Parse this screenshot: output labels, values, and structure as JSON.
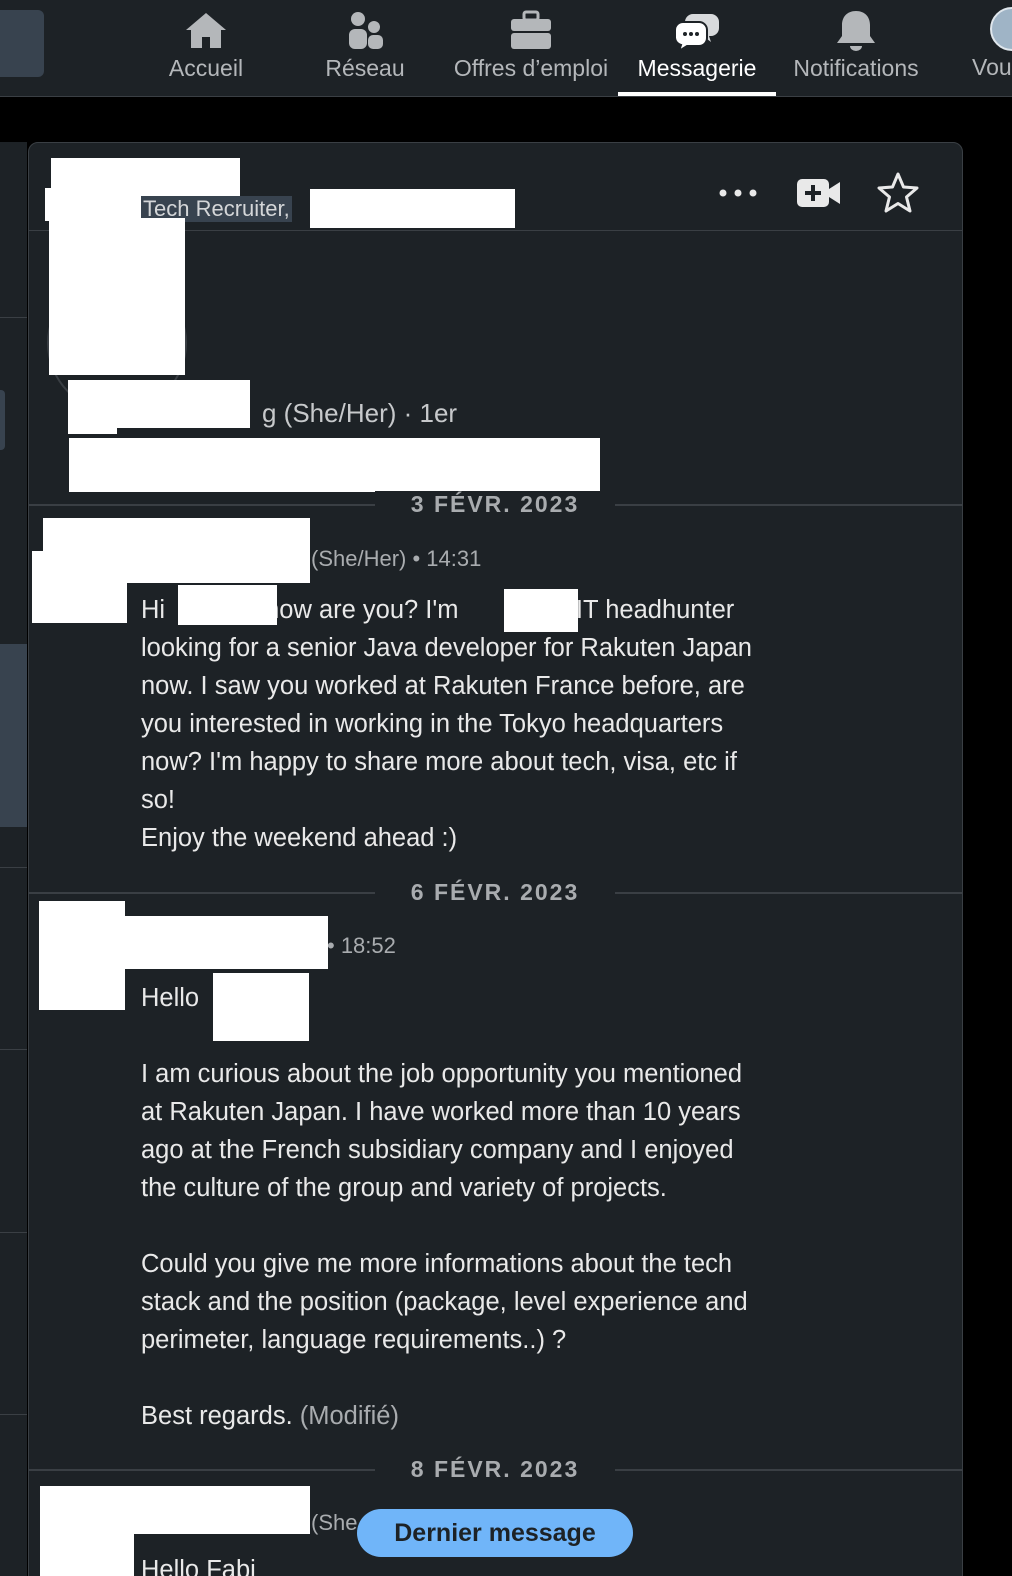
{
  "nav": {
    "items": [
      {
        "label": "Accueil",
        "icon": "home-icon"
      },
      {
        "label": "Réseau",
        "icon": "people-icon"
      },
      {
        "label": "Offres d’emploi",
        "icon": "briefcase-icon"
      },
      {
        "label": "Messagerie",
        "icon": "chat-icon",
        "active": true
      },
      {
        "label": "Notifications",
        "icon": "bell-icon"
      },
      {
        "label": "Vou",
        "icon": "avatar"
      }
    ]
  },
  "conversation": {
    "header": {
      "title": "Tech Recruiter,",
      "actions": [
        "more-icon",
        "video-icon",
        "star-icon"
      ]
    },
    "profile": {
      "name_suffix": "g (She/Her) · 1er"
    },
    "groups": [
      {
        "date": "3 FÉVR. 2023",
        "meta": "(She/Her) • 14:31",
        "lines": [
          "Hi",
          "how are you? I'm",
          "an IT headhunter",
          "looking for a senior Java developer for Rakuten Japan",
          "now. I saw you worked at Rakuten France before, are",
          "you interested in working in the Tokyo headquarters",
          "now? I'm happy to share more about tech, visa, etc if",
          "so!",
          "Enjoy the weekend ahead :)"
        ]
      },
      {
        "date": "6 FÉVR. 2023",
        "meta": "• 18:52",
        "greeting": "Hello",
        "paragraph1": [
          "I am curious about the job opportunity you mentioned",
          "at Rakuten Japan. I have worked more than 10 years",
          "ago at the French subsidiary company and I enjoyed",
          "the culture of the group and variety of projects."
        ],
        "paragraph2": [
          "Could you give me more informations about the tech",
          "stack and the position (package, level experience and",
          "perimeter, language requirements..) ?"
        ],
        "closing": "Best regards.",
        "edited": "(Modifié)"
      },
      {
        "date": "8 FÉVR. 2023",
        "meta": "(She",
        "preview": "Hello Fabi"
      }
    ],
    "jump_button": "Dernier message"
  },
  "colors": {
    "background": "#000000",
    "surface": "#1d2226",
    "divider": "#3a3f44",
    "accent": "#70b5f9",
    "text": "#e9e9e9",
    "muted": "#a9acaf"
  }
}
